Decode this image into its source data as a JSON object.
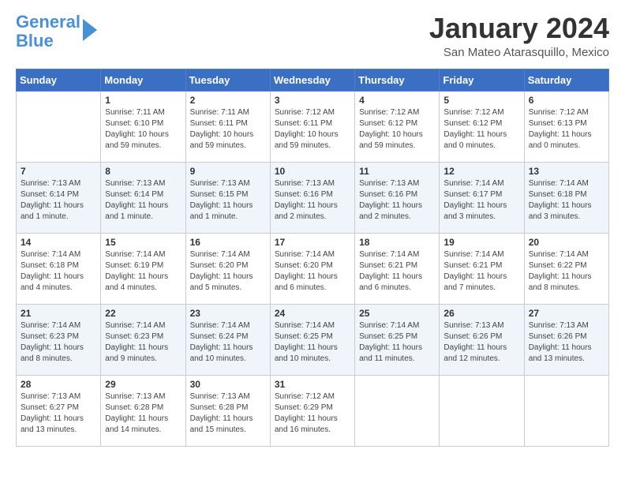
{
  "header": {
    "logo_line1": "General",
    "logo_line2": "Blue",
    "title": "January 2024",
    "location": "San Mateo Atarasquillo, Mexico"
  },
  "days_of_week": [
    "Sunday",
    "Monday",
    "Tuesday",
    "Wednesday",
    "Thursday",
    "Friday",
    "Saturday"
  ],
  "weeks": [
    [
      {
        "day": "",
        "sunrise": "",
        "sunset": "",
        "daylight": ""
      },
      {
        "day": "1",
        "sunrise": "Sunrise: 7:11 AM",
        "sunset": "Sunset: 6:10 PM",
        "daylight": "Daylight: 10 hours and 59 minutes."
      },
      {
        "day": "2",
        "sunrise": "Sunrise: 7:11 AM",
        "sunset": "Sunset: 6:11 PM",
        "daylight": "Daylight: 10 hours and 59 minutes."
      },
      {
        "day": "3",
        "sunrise": "Sunrise: 7:12 AM",
        "sunset": "Sunset: 6:11 PM",
        "daylight": "Daylight: 10 hours and 59 minutes."
      },
      {
        "day": "4",
        "sunrise": "Sunrise: 7:12 AM",
        "sunset": "Sunset: 6:12 PM",
        "daylight": "Daylight: 10 hours and 59 minutes."
      },
      {
        "day": "5",
        "sunrise": "Sunrise: 7:12 AM",
        "sunset": "Sunset: 6:12 PM",
        "daylight": "Daylight: 11 hours and 0 minutes."
      },
      {
        "day": "6",
        "sunrise": "Sunrise: 7:12 AM",
        "sunset": "Sunset: 6:13 PM",
        "daylight": "Daylight: 11 hours and 0 minutes."
      }
    ],
    [
      {
        "day": "7",
        "sunrise": "Sunrise: 7:13 AM",
        "sunset": "Sunset: 6:14 PM",
        "daylight": "Daylight: 11 hours and 1 minute."
      },
      {
        "day": "8",
        "sunrise": "Sunrise: 7:13 AM",
        "sunset": "Sunset: 6:14 PM",
        "daylight": "Daylight: 11 hours and 1 minute."
      },
      {
        "day": "9",
        "sunrise": "Sunrise: 7:13 AM",
        "sunset": "Sunset: 6:15 PM",
        "daylight": "Daylight: 11 hours and 1 minute."
      },
      {
        "day": "10",
        "sunrise": "Sunrise: 7:13 AM",
        "sunset": "Sunset: 6:16 PM",
        "daylight": "Daylight: 11 hours and 2 minutes."
      },
      {
        "day": "11",
        "sunrise": "Sunrise: 7:13 AM",
        "sunset": "Sunset: 6:16 PM",
        "daylight": "Daylight: 11 hours and 2 minutes."
      },
      {
        "day": "12",
        "sunrise": "Sunrise: 7:14 AM",
        "sunset": "Sunset: 6:17 PM",
        "daylight": "Daylight: 11 hours and 3 minutes."
      },
      {
        "day": "13",
        "sunrise": "Sunrise: 7:14 AM",
        "sunset": "Sunset: 6:18 PM",
        "daylight": "Daylight: 11 hours and 3 minutes."
      }
    ],
    [
      {
        "day": "14",
        "sunrise": "Sunrise: 7:14 AM",
        "sunset": "Sunset: 6:18 PM",
        "daylight": "Daylight: 11 hours and 4 minutes."
      },
      {
        "day": "15",
        "sunrise": "Sunrise: 7:14 AM",
        "sunset": "Sunset: 6:19 PM",
        "daylight": "Daylight: 11 hours and 4 minutes."
      },
      {
        "day": "16",
        "sunrise": "Sunrise: 7:14 AM",
        "sunset": "Sunset: 6:20 PM",
        "daylight": "Daylight: 11 hours and 5 minutes."
      },
      {
        "day": "17",
        "sunrise": "Sunrise: 7:14 AM",
        "sunset": "Sunset: 6:20 PM",
        "daylight": "Daylight: 11 hours and 6 minutes."
      },
      {
        "day": "18",
        "sunrise": "Sunrise: 7:14 AM",
        "sunset": "Sunset: 6:21 PM",
        "daylight": "Daylight: 11 hours and 6 minutes."
      },
      {
        "day": "19",
        "sunrise": "Sunrise: 7:14 AM",
        "sunset": "Sunset: 6:21 PM",
        "daylight": "Daylight: 11 hours and 7 minutes."
      },
      {
        "day": "20",
        "sunrise": "Sunrise: 7:14 AM",
        "sunset": "Sunset: 6:22 PM",
        "daylight": "Daylight: 11 hours and 8 minutes."
      }
    ],
    [
      {
        "day": "21",
        "sunrise": "Sunrise: 7:14 AM",
        "sunset": "Sunset: 6:23 PM",
        "daylight": "Daylight: 11 hours and 8 minutes."
      },
      {
        "day": "22",
        "sunrise": "Sunrise: 7:14 AM",
        "sunset": "Sunset: 6:23 PM",
        "daylight": "Daylight: 11 hours and 9 minutes."
      },
      {
        "day": "23",
        "sunrise": "Sunrise: 7:14 AM",
        "sunset": "Sunset: 6:24 PM",
        "daylight": "Daylight: 11 hours and 10 minutes."
      },
      {
        "day": "24",
        "sunrise": "Sunrise: 7:14 AM",
        "sunset": "Sunset: 6:25 PM",
        "daylight": "Daylight: 11 hours and 10 minutes."
      },
      {
        "day": "25",
        "sunrise": "Sunrise: 7:14 AM",
        "sunset": "Sunset: 6:25 PM",
        "daylight": "Daylight: 11 hours and 11 minutes."
      },
      {
        "day": "26",
        "sunrise": "Sunrise: 7:13 AM",
        "sunset": "Sunset: 6:26 PM",
        "daylight": "Daylight: 11 hours and 12 minutes."
      },
      {
        "day": "27",
        "sunrise": "Sunrise: 7:13 AM",
        "sunset": "Sunset: 6:26 PM",
        "daylight": "Daylight: 11 hours and 13 minutes."
      }
    ],
    [
      {
        "day": "28",
        "sunrise": "Sunrise: 7:13 AM",
        "sunset": "Sunset: 6:27 PM",
        "daylight": "Daylight: 11 hours and 13 minutes."
      },
      {
        "day": "29",
        "sunrise": "Sunrise: 7:13 AM",
        "sunset": "Sunset: 6:28 PM",
        "daylight": "Daylight: 11 hours and 14 minutes."
      },
      {
        "day": "30",
        "sunrise": "Sunrise: 7:13 AM",
        "sunset": "Sunset: 6:28 PM",
        "daylight": "Daylight: 11 hours and 15 minutes."
      },
      {
        "day": "31",
        "sunrise": "Sunrise: 7:12 AM",
        "sunset": "Sunset: 6:29 PM",
        "daylight": "Daylight: 11 hours and 16 minutes."
      },
      {
        "day": "",
        "sunrise": "",
        "sunset": "",
        "daylight": ""
      },
      {
        "day": "",
        "sunrise": "",
        "sunset": "",
        "daylight": ""
      },
      {
        "day": "",
        "sunrise": "",
        "sunset": "",
        "daylight": ""
      }
    ]
  ]
}
